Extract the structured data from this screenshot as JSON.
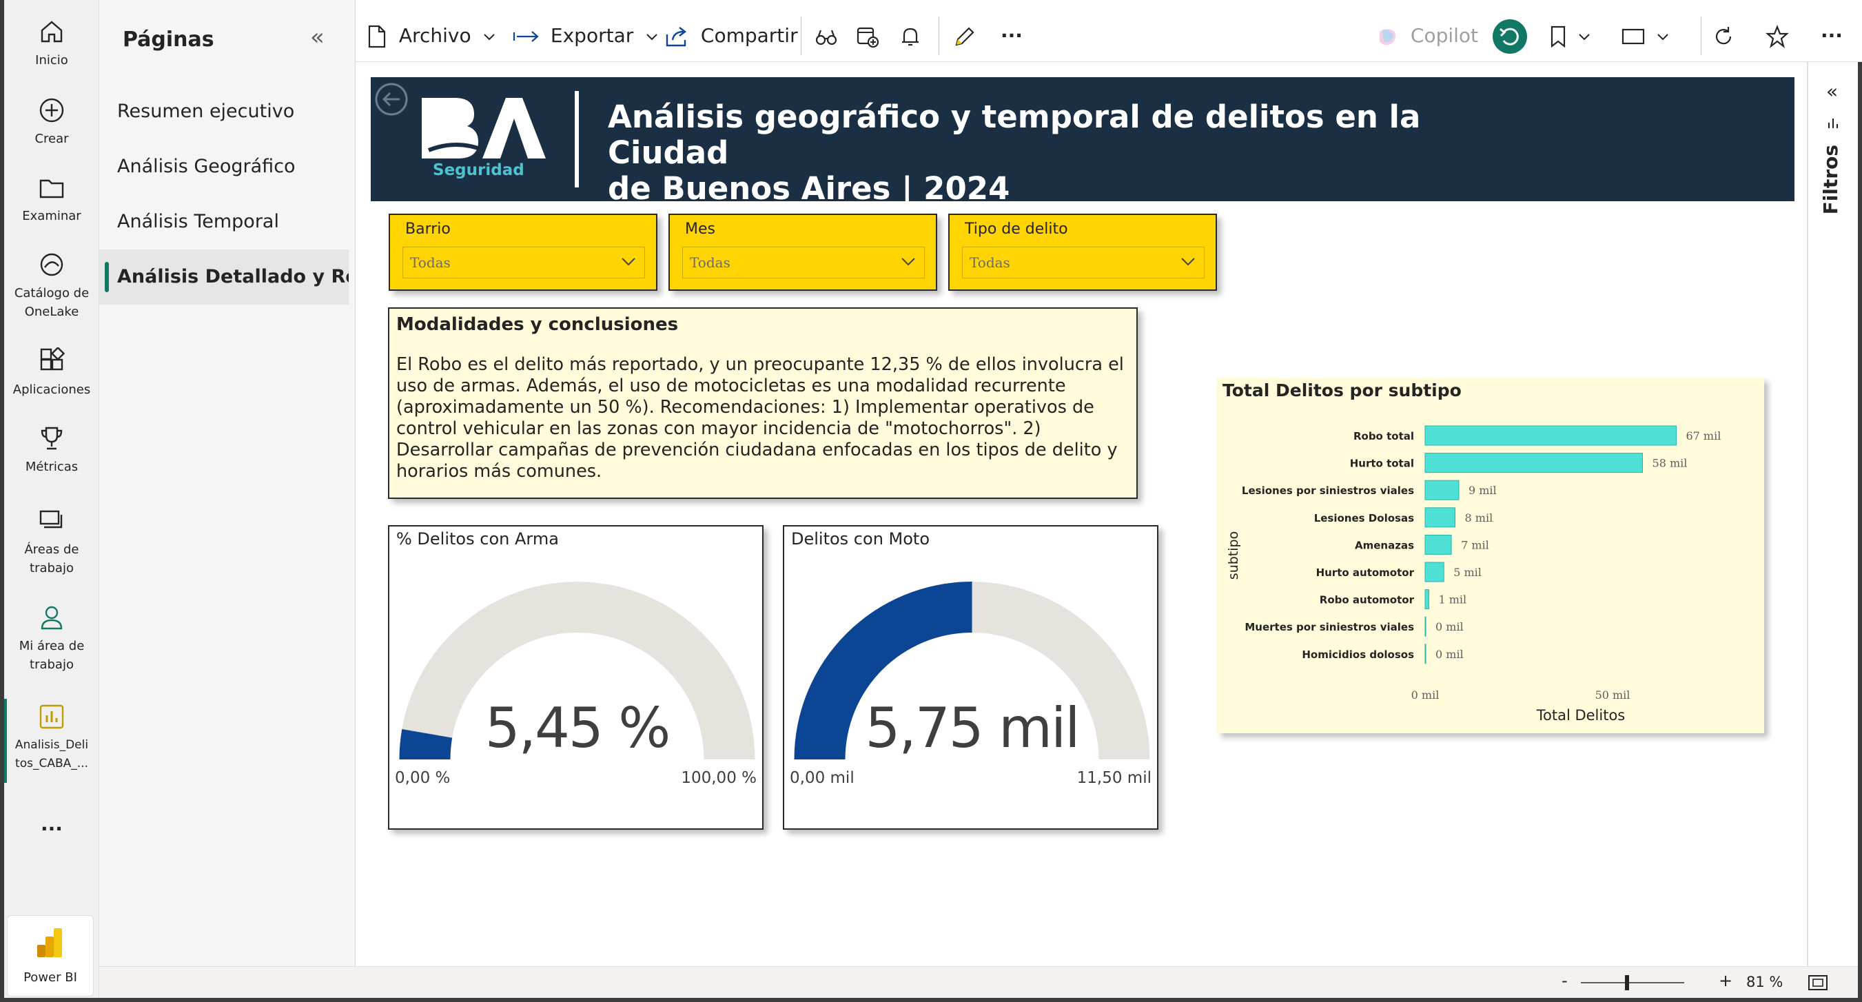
{
  "rail": {
    "items": [
      {
        "label": "Inicio",
        "icon": "home-icon"
      },
      {
        "label": "Crear",
        "icon": "plus-circle-icon"
      },
      {
        "label": "Examinar",
        "icon": "folder-icon"
      },
      {
        "label": "Catálogo de OneLake",
        "icon": "onelake-icon"
      },
      {
        "label": "Aplicaciones",
        "icon": "apps-icon"
      },
      {
        "label": "Métricas",
        "icon": "trophy-icon"
      },
      {
        "label": "Áreas de trabajo",
        "icon": "workspaces-icon"
      },
      {
        "label": "Mi área de trabajo",
        "icon": "person-icon"
      },
      {
        "label": "Analisis_Delitos_CABA_...",
        "icon": "report-icon"
      }
    ],
    "more": "...",
    "product": "Power BI"
  },
  "pages_pane": {
    "title": "Páginas",
    "items": [
      {
        "label": "Resumen ejecutivo"
      },
      {
        "label": "Análisis Geográfico"
      },
      {
        "label": "Análisis Temporal"
      },
      {
        "label": "Análisis Detallado y Re..."
      }
    ],
    "active_index": 3
  },
  "toolbar": {
    "archivo": "Archivo",
    "exportar": "Exportar",
    "compartir": "Compartir",
    "copilot": "Copilot",
    "more": "···"
  },
  "filters_label": "Filtros",
  "status": {
    "zoom": "81 %",
    "minus": "-",
    "plus": "+"
  },
  "report": {
    "title_line1": "Análisis geográfico y temporal de delitos en la Ciudad",
    "title_line2": "de Buenos Aires | 2024",
    "logo_text": "BA",
    "logo_sub": "Seguridad",
    "header_bg": "#1a2e44"
  },
  "slicers": [
    {
      "label": "Barrio",
      "value": "Todas"
    },
    {
      "label": "Mes",
      "value": "Todas"
    },
    {
      "label": "Tipo de delito",
      "value": "Todas"
    }
  ],
  "conclusions": {
    "title": "Modalidades y conclusiones",
    "body": "El Robo es el delito más reportado, y un preocupante 12,35 % de ellos involucra el uso de armas. Además, el uso de motocicletas es una modalidad recurrente (aproximadamente un 50 %). Recomendaciones: 1) Implementar operativos de control vehicular en las zonas con mayor incidencia de \"motochorros\". 2) Desarrollar campañas de prevención ciudadana enfocadas en los tipos de delito y horarios más comunes."
  },
  "gauges": [
    {
      "title": "% Delitos con Arma",
      "value_label": "5,45 %",
      "min_label": "0,00 %",
      "max_label": "100,00 %",
      "fraction": 0.0545
    },
    {
      "title": "Delitos con Moto",
      "value_label": "5,75 mil",
      "min_label": "0,00 mil",
      "max_label": "11,50 mil",
      "fraction": 0.5
    }
  ],
  "colors": {
    "slicer": "#ffd400",
    "bar": "#4ee0d4",
    "gauge_fill": "#0d4595",
    "gauge_track": "#e6e2dd",
    "card_bg": "#fffbdb"
  },
  "chart_data": {
    "type": "bar",
    "orientation": "horizontal",
    "title": "Total Delitos por subtipo",
    "xlabel": "Total Delitos",
    "ylabel": "subtipo",
    "categories": [
      "Robo total",
      "Hurto total",
      "Lesiones por siniestros viales",
      "Lesiones Dolosas",
      "Amenazas",
      "Hurto automotor",
      "Robo automotor",
      "Muertes por siniestros viales",
      "Homicidios dolosos"
    ],
    "values": [
      67,
      58,
      9,
      8,
      7,
      5,
      1,
      0,
      0
    ],
    "value_labels": [
      "67 mil",
      "58 mil",
      "9 mil",
      "8 mil",
      "7 mil",
      "5 mil",
      "1 mil",
      "0 mil",
      "0 mil"
    ],
    "x_ticks": [
      "0 mil",
      "50 mil"
    ],
    "xlim": [
      0,
      100
    ],
    "grid": false
  }
}
